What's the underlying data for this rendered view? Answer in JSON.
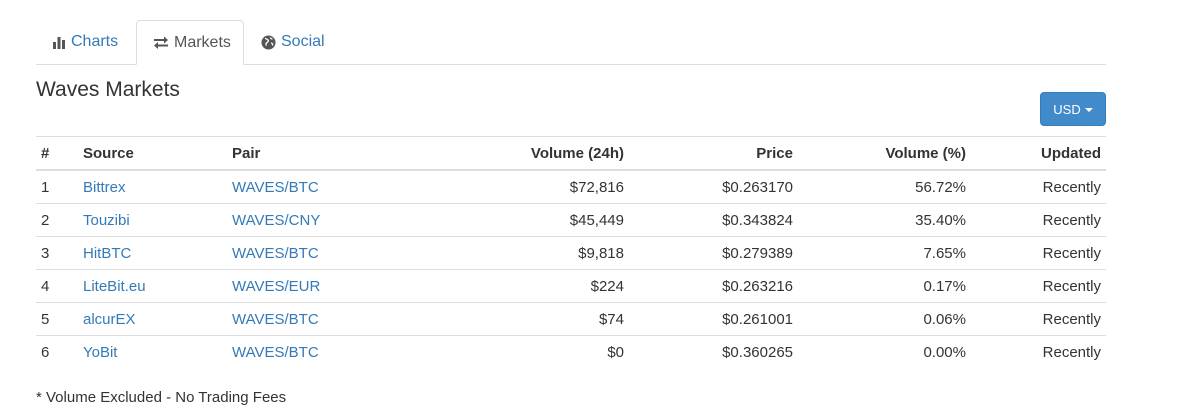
{
  "tabs": [
    {
      "label": "Charts",
      "icon": "bar-chart-icon"
    },
    {
      "label": "Markets",
      "icon": "exchange-arrows-icon"
    },
    {
      "label": "Social",
      "icon": "globe-icon"
    }
  ],
  "active_tab": "Markets",
  "title": "Waves Markets",
  "currency_button": {
    "label": "USD"
  },
  "table": {
    "headers": [
      "#",
      "Source",
      "Pair",
      "Volume (24h)",
      "Price",
      "Volume (%)",
      "Updated"
    ],
    "rows": [
      {
        "rank": "1",
        "source": "Bittrex",
        "pair": "WAVES/BTC",
        "volume": "$72,816",
        "price": "$0.263170",
        "volume_pct": "56.72%",
        "updated": "Recently"
      },
      {
        "rank": "2",
        "source": "Touzibi",
        "pair": "WAVES/CNY",
        "volume": "$45,449",
        "price": "$0.343824",
        "volume_pct": "35.40%",
        "updated": "Recently"
      },
      {
        "rank": "3",
        "source": "HitBTC",
        "pair": "WAVES/BTC",
        "volume": "$9,818",
        "price": "$0.279389",
        "volume_pct": "7.65%",
        "updated": "Recently"
      },
      {
        "rank": "4",
        "source": "LiteBit.eu",
        "pair": "WAVES/EUR",
        "volume": "$224",
        "price": "$0.263216",
        "volume_pct": "0.17%",
        "updated": "Recently"
      },
      {
        "rank": "5",
        "source": "alcurEX",
        "pair": "WAVES/BTC",
        "volume": "$74",
        "price": "$0.261001",
        "volume_pct": "0.06%",
        "updated": "Recently"
      },
      {
        "rank": "6",
        "source": "YoBit",
        "pair": "WAVES/BTC",
        "volume": "$0",
        "price": "$0.360265",
        "volume_pct": "0.00%",
        "updated": "Recently"
      }
    ]
  },
  "footnote": "* Volume Excluded - No Trading Fees",
  "colors": {
    "link": "#337ab7",
    "button": "#428bca",
    "border": "#dddddd",
    "text": "#333333"
  }
}
